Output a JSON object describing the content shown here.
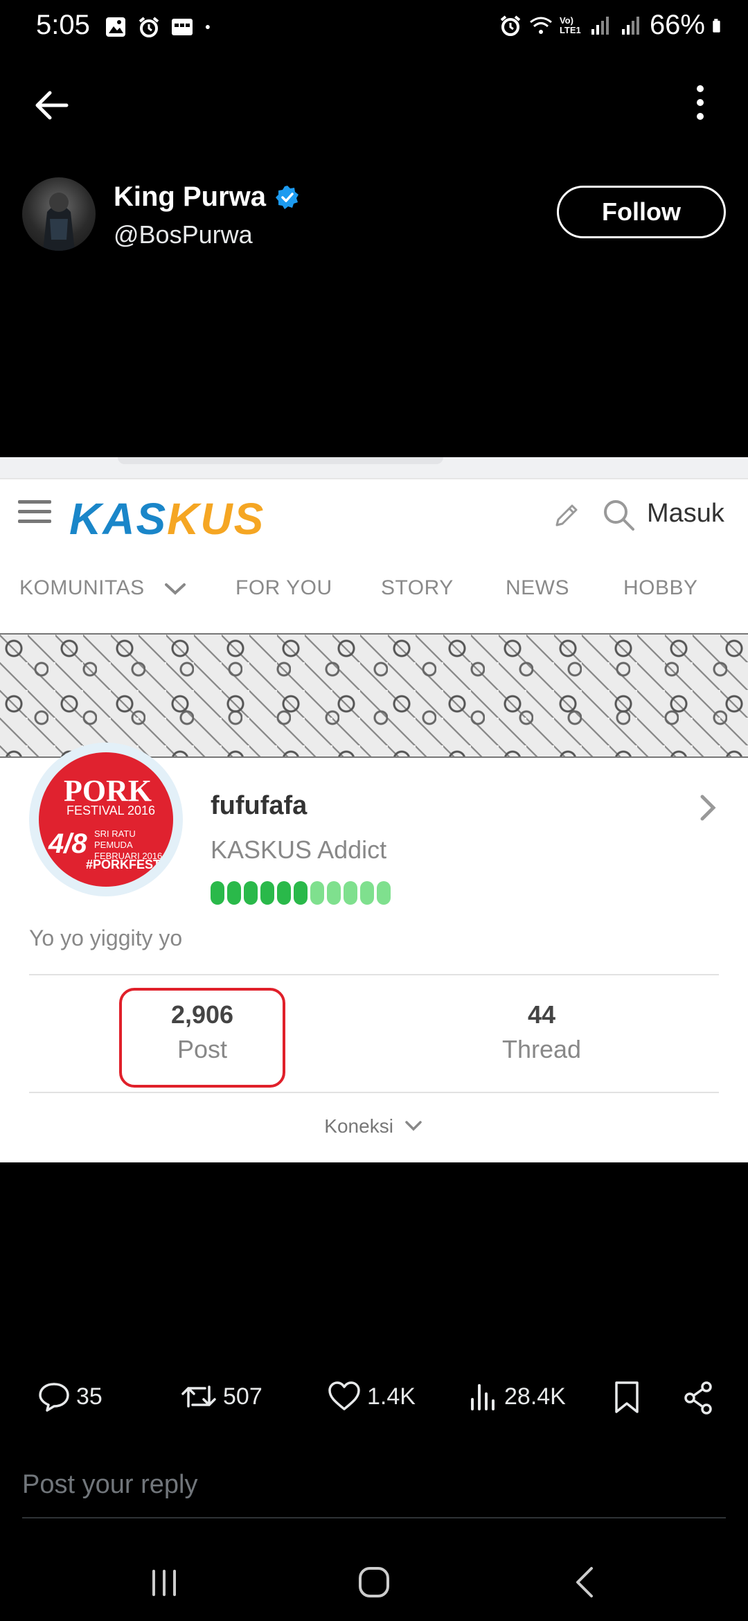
{
  "status_bar": {
    "time": "5:05",
    "battery": "66%",
    "network_label": "Vo) LTE1",
    "icons": [
      "gallery-icon",
      "alarm-icon",
      "keyboard-icon",
      "dot-icon",
      "alarm-icon",
      "wifi-icon",
      "signal-icon",
      "signal-icon",
      "battery-icon"
    ]
  },
  "header": {
    "back_icon": "arrow-left-icon",
    "more_icon": "more-vertical-icon"
  },
  "tweet": {
    "display_name": "King Purwa",
    "handle": "@BosPurwa",
    "verified": true,
    "follow_label": "Follow"
  },
  "embed": {
    "site": {
      "logo_part1": "KAS",
      "logo_part2": "KUS",
      "login_label": "Masuk",
      "tabs": [
        "KOMUNITAS",
        "FOR YOU",
        "STORY",
        "NEWS",
        "HOBBY"
      ]
    },
    "profile": {
      "avatar_text_line1": "PORK",
      "avatar_text_line2": "FESTIVAL 2016",
      "avatar_text_line3": "4/8",
      "avatar_text_line4": "SRI RATU PEMUDA FEBRUARI 2016",
      "avatar_text_line5": "#PORKFEST",
      "username": "fufufafa",
      "rank": "KASKUS Addict",
      "rank_dots_filled": 6,
      "rank_dots_total": 11,
      "rank_color_dark": "#2ab94a",
      "rank_color_light": "#7fe08e",
      "bio": "Yo yo yiggity yo",
      "stats": [
        {
          "value": "2,906",
          "label": "Post"
        },
        {
          "value": "44",
          "label": "Thread"
        }
      ],
      "connections_label": "Koneksi",
      "highlight_color": "#e0202a"
    }
  },
  "actions": {
    "replies": "35",
    "reposts": "507",
    "likes": "1.4K",
    "views": "28.4K"
  },
  "reply_box": {
    "placeholder": "Post your reply"
  },
  "nav_bar": {
    "icons": [
      "recent-apps-icon",
      "home-icon",
      "back-icon"
    ]
  }
}
